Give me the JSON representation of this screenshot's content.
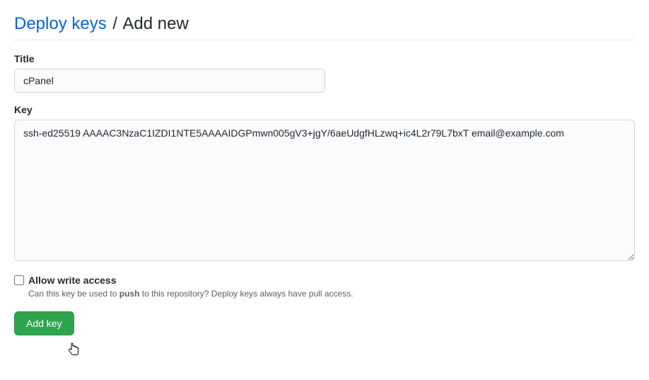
{
  "header": {
    "link_text": "Deploy keys",
    "separator": "/",
    "current": "Add new"
  },
  "form": {
    "title": {
      "label": "Title",
      "value": "cPanel"
    },
    "key": {
      "label": "Key",
      "value": "ssh-ed25519 AAAAC3NzaC1IZDI1NTE5AAAAIDGPmwn005gV3+jgY/6aeUdgfHLzwq+ic4L2r79L7bxT email@example.com"
    },
    "write_access": {
      "label": "Allow write access",
      "checked": false,
      "note_prefix": "Can this key be used to ",
      "note_bold": "push",
      "note_suffix": " to this repository? Deploy keys always have pull access."
    },
    "submit_label": "Add key"
  },
  "icons": {
    "cursor": "pointer-cursor-icon"
  }
}
